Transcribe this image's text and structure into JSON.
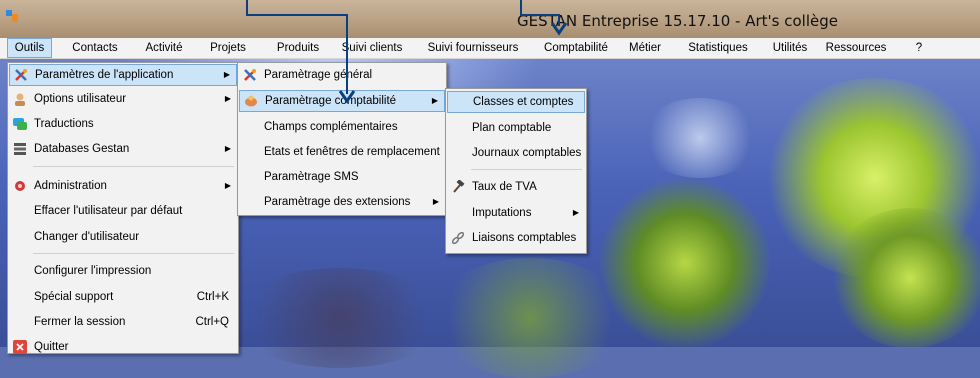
{
  "window": {
    "title": "GESTAN Entreprise 15.17.10 - Art's collège"
  },
  "menubar": [
    "Outils",
    "Contacts",
    "Activité",
    "Projets",
    "Produits",
    "Suivi clients",
    "Suivi fournisseurs",
    "Comptabilité",
    "Métier",
    "Statistiques",
    "Utilités",
    "Ressources",
    "?"
  ],
  "outils_menu": {
    "items": [
      {
        "label": "Paramètres de l'application",
        "icon": "tools-icon"
      },
      {
        "label": "Options utilisateur",
        "icon": "user-icon"
      },
      {
        "label": "Traductions",
        "icon": "chat-icon"
      },
      {
        "label": "Databases Gestan",
        "icon": "database-icon"
      },
      {
        "label": "Administration",
        "icon": "admin-icon"
      },
      {
        "label": "Effacer l'utilisateur par défaut"
      },
      {
        "label": "Changer d'utilisateur"
      },
      {
        "label": "Configurer l'impression"
      },
      {
        "label": "Spécial support",
        "shortcut": "Ctrl+K"
      },
      {
        "label": "Fermer la session",
        "shortcut": "Ctrl+Q"
      },
      {
        "label": "Quitter",
        "icon": "close-icon"
      }
    ]
  },
  "params_menu": {
    "items": [
      {
        "label": "Paramètrage général",
        "icon": "tools-icon"
      },
      {
        "label": "Paramètrage comptabilité",
        "icon": "piggy-bank-icon"
      },
      {
        "label": "Champs complémentaires"
      },
      {
        "label": "Etats et fenêtres de remplacement"
      },
      {
        "label": "Paramètrage SMS"
      },
      {
        "label": "Paramètrage des extensions"
      }
    ]
  },
  "compta_menu": {
    "items": [
      {
        "label": "Classes et comptes"
      },
      {
        "label": "Plan comptable"
      },
      {
        "label": "Journaux comptables"
      },
      {
        "label": "Taux de TVA",
        "icon": "hammer-icon"
      },
      {
        "label": "Imputations"
      },
      {
        "label": "Liaisons comptables",
        "icon": "link-icon"
      }
    ]
  },
  "colors": {
    "highlight": "#cce4f7",
    "highlight_border": "#7aa7d6",
    "callout": "#0b3f84"
  }
}
